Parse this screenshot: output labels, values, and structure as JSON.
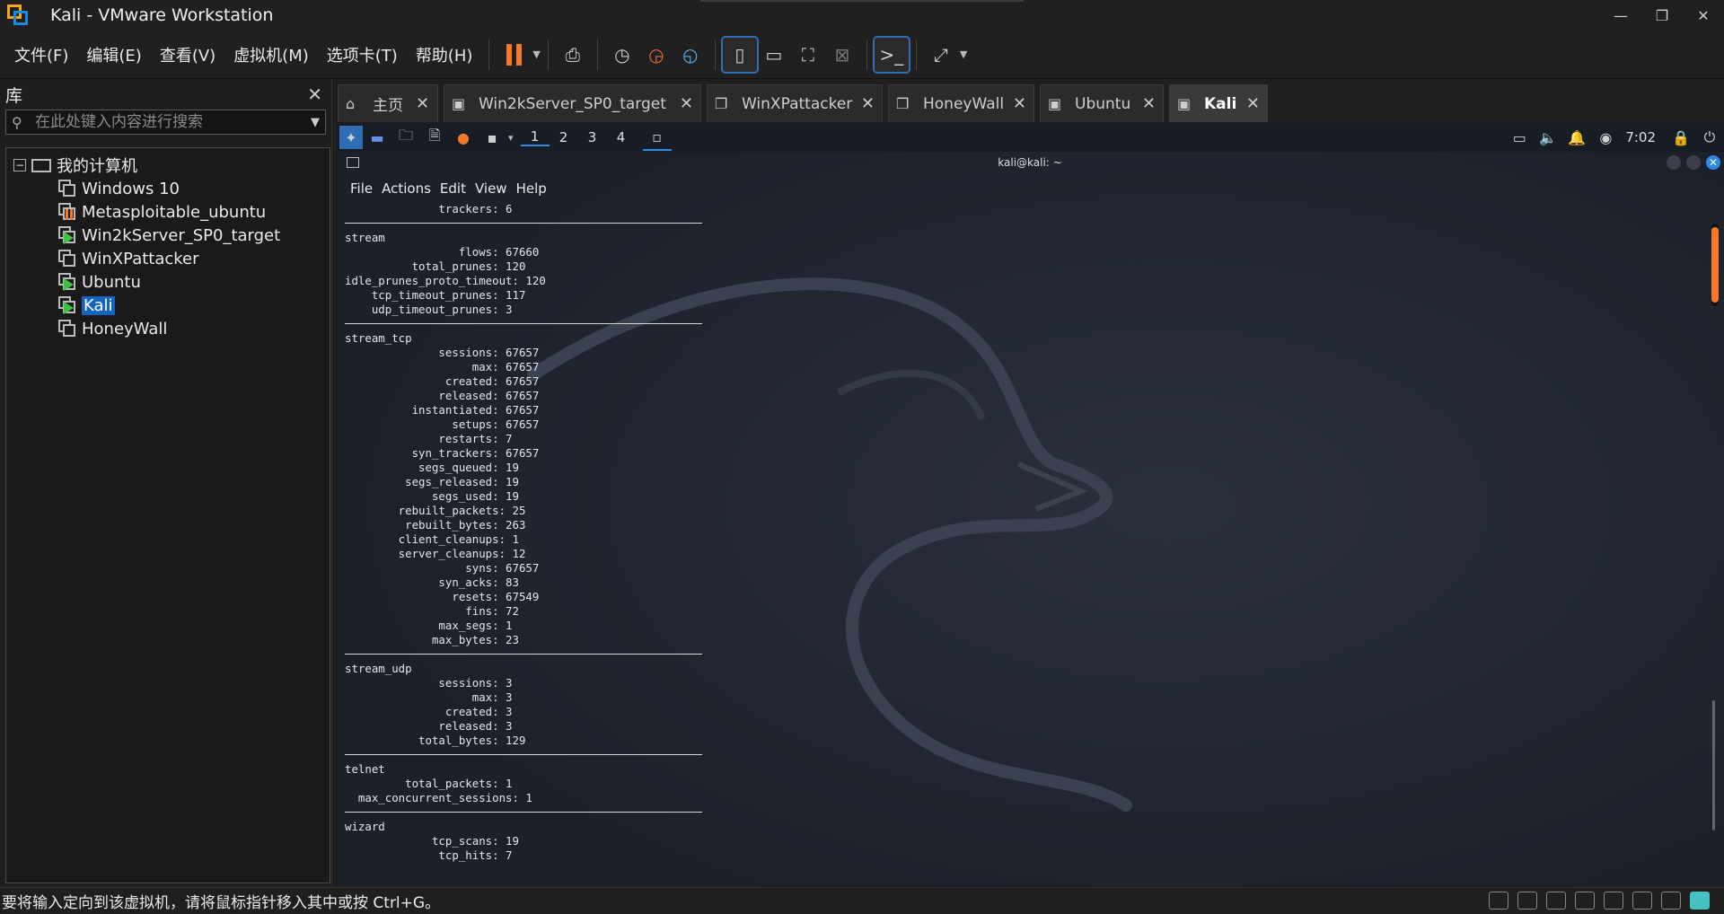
{
  "window": {
    "title": "Kali - VMware Workstation",
    "min": "—",
    "restore": "❐",
    "close": "✕"
  },
  "menu": [
    "文件(F)",
    "编辑(E)",
    "查看(V)",
    "虚拟机(M)",
    "选项卡(T)",
    "帮助(H)"
  ],
  "library": {
    "title": "库",
    "search_placeholder": "在此处键入内容进行搜索",
    "root": "我的计算机",
    "vms": [
      {
        "name": "Windows 10",
        "state": "off"
      },
      {
        "name": "Metasploitable_ubuntu",
        "state": "paused"
      },
      {
        "name": "Win2kServer_SP0_target",
        "state": "running"
      },
      {
        "name": "WinXPattacker",
        "state": "off"
      },
      {
        "name": "Ubuntu",
        "state": "running"
      },
      {
        "name": "Kali",
        "state": "running",
        "selected": true
      },
      {
        "name": "HoneyWall",
        "state": "off"
      }
    ]
  },
  "tabs": [
    {
      "label": "主页",
      "icon": "home-icon"
    },
    {
      "label": "Win2kServer_SP0_target",
      "icon": "vm-running-icon"
    },
    {
      "label": "WinXPattacker",
      "icon": "vm-off-icon"
    },
    {
      "label": "HoneyWall",
      "icon": "vm-off-icon"
    },
    {
      "label": "Ubuntu",
      "icon": "vm-running-icon"
    },
    {
      "label": "Kali",
      "icon": "vm-running-icon",
      "active": true
    }
  ],
  "guest": {
    "workspaces": [
      "1",
      "2",
      "3",
      "4"
    ],
    "clock": "7:02",
    "terminal_title": "kali@kali: ~",
    "terminal_menu": [
      "File",
      "Actions",
      "Edit",
      "View",
      "Help"
    ],
    "sections": [
      {
        "name": "",
        "lines": [
          "              trackers: 6"
        ]
      },
      {
        "name": "stream",
        "lines": [
          "                 flows: 67660",
          "          total_prunes: 120",
          "idle_prunes_proto_timeout: 120",
          "    tcp_timeout_prunes: 117",
          "    udp_timeout_prunes: 3"
        ]
      },
      {
        "name": "stream_tcp",
        "lines": [
          "              sessions: 67657",
          "                   max: 67657",
          "               created: 67657",
          "              released: 67657",
          "          instantiated: 67657",
          "                setups: 67657",
          "              restarts: 7",
          "          syn_trackers: 67657",
          "           segs_queued: 19",
          "         segs_released: 19",
          "             segs_used: 19",
          "        rebuilt_packets: 25",
          "         rebuilt_bytes: 263",
          "        client_cleanups: 1",
          "        server_cleanups: 12",
          "                  syns: 67657",
          "              syn_acks: 83",
          "                resets: 67549",
          "                  fins: 72",
          "              max_segs: 1",
          "             max_bytes: 23"
        ]
      },
      {
        "name": "stream_udp",
        "lines": [
          "              sessions: 3",
          "                   max: 3",
          "               created: 3",
          "              released: 3",
          "           total_bytes: 129"
        ]
      },
      {
        "name": "telnet",
        "lines": [
          "         total_packets: 1",
          "  max_concurrent_sessions: 1"
        ]
      },
      {
        "name": "wizard",
        "lines": [
          "             tcp_scans: 19",
          "              tcp_hits: 7"
        ]
      }
    ]
  },
  "status": {
    "text": "要将输入定向到该虚拟机，请将鼠标指针移入其中或按 Ctrl+G。"
  },
  "colors": {
    "accent": "#1565c0",
    "pause": "#f5792a",
    "run": "#3cc23c",
    "vm_bg": "#212631"
  }
}
